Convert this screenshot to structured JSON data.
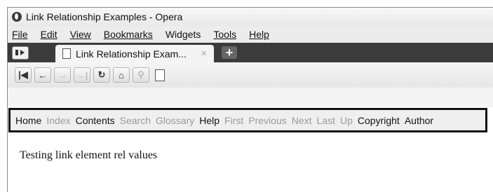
{
  "window": {
    "title": "Link Relationship Examples - Opera"
  },
  "menu": [
    {
      "label": "File"
    },
    {
      "label": "Edit"
    },
    {
      "label": "View"
    },
    {
      "label": "Bookmarks"
    },
    {
      "label": "Widgets"
    },
    {
      "label": "Tools"
    },
    {
      "label": "Help"
    }
  ],
  "tab": {
    "title": "Link Relationship Exam...",
    "close": "×"
  },
  "new_tab": "+",
  "nav_icons": [
    "rewind-icon",
    "back-arrow-icon",
    "forward-arrow-icon",
    "fast-forward-icon",
    "reload-icon",
    "home-icon",
    "wand-icon",
    "document-icon"
  ],
  "link_bar": [
    {
      "label": "Home",
      "enabled": true
    },
    {
      "label": "Index",
      "enabled": false
    },
    {
      "label": "Contents",
      "enabled": true
    },
    {
      "label": "Search",
      "enabled": false
    },
    {
      "label": "Glossary",
      "enabled": false
    },
    {
      "label": "Help",
      "enabled": true
    },
    {
      "label": "First",
      "enabled": false
    },
    {
      "label": "Previous",
      "enabled": false
    },
    {
      "label": "Next",
      "enabled": false
    },
    {
      "label": "Last",
      "enabled": false
    },
    {
      "label": "Up",
      "enabled": false
    },
    {
      "label": "Copyright",
      "enabled": true
    },
    {
      "label": "Author",
      "enabled": true
    }
  ],
  "page": {
    "text": "Testing link element rel values"
  }
}
